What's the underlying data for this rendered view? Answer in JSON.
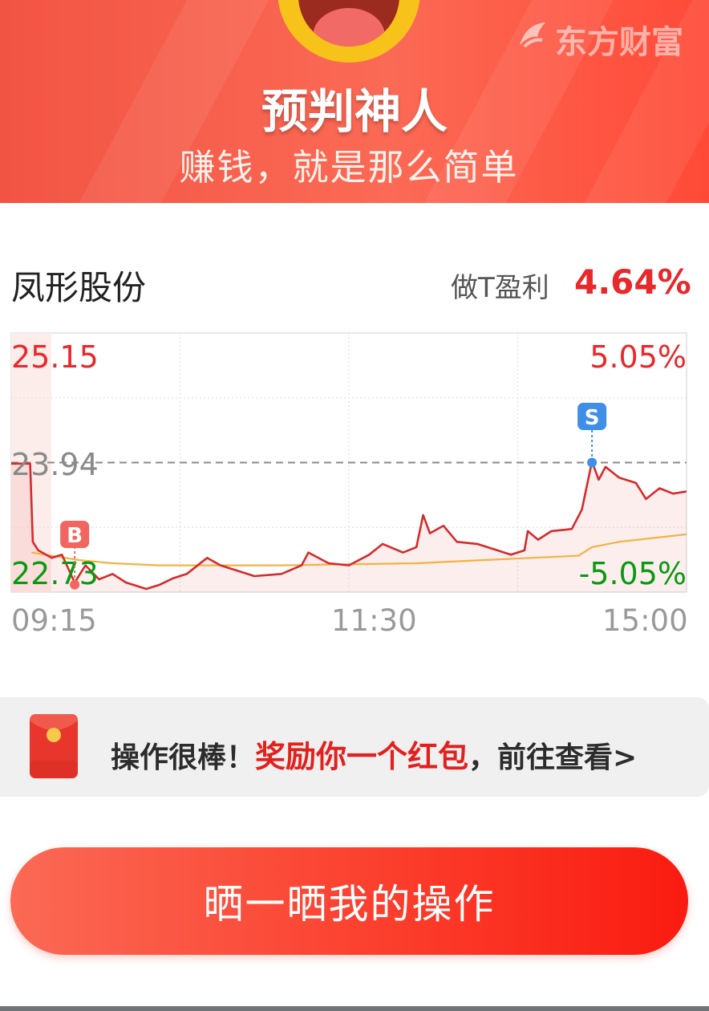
{
  "header": {
    "brand": "东方财富",
    "title": "预判神人",
    "subtitle": "赚钱，就是那么简单"
  },
  "stock": {
    "name": "凤形股份",
    "profit_label": "做T盈利",
    "profit_value": "4.64%"
  },
  "chart_data": {
    "type": "line",
    "y_high_label": "25.15",
    "y_ref_label": "23.94",
    "y_low_label": "22.73",
    "pct_high_label": "5.05%",
    "pct_low_label": "-5.05%",
    "x_ticks": [
      "09:15",
      "11:30",
      "15:00"
    ],
    "ylim": [
      22.73,
      25.15
    ],
    "ref_price": 23.94,
    "markers": [
      {
        "label": "B",
        "x": 0.094,
        "y": 22.8
      },
      {
        "label": "S",
        "x": 0.86,
        "y": 23.94
      }
    ],
    "price_series": [
      [
        0.0,
        23.93
      ],
      [
        0.028,
        23.93
      ],
      [
        0.032,
        23.2
      ],
      [
        0.04,
        23.12
      ],
      [
        0.06,
        23.05
      ],
      [
        0.075,
        23.08
      ],
      [
        0.094,
        22.82
      ],
      [
        0.11,
        22.98
      ],
      [
        0.13,
        22.85
      ],
      [
        0.15,
        22.9
      ],
      [
        0.17,
        22.82
      ],
      [
        0.2,
        22.76
      ],
      [
        0.22,
        22.8
      ],
      [
        0.24,
        22.86
      ],
      [
        0.26,
        22.9
      ],
      [
        0.29,
        23.05
      ],
      [
        0.31,
        22.98
      ],
      [
        0.34,
        22.92
      ],
      [
        0.36,
        22.88
      ],
      [
        0.4,
        22.9
      ],
      [
        0.43,
        22.98
      ],
      [
        0.44,
        23.1
      ],
      [
        0.47,
        23.0
      ],
      [
        0.5,
        22.98
      ],
      [
        0.53,
        23.08
      ],
      [
        0.55,
        23.18
      ],
      [
        0.58,
        23.1
      ],
      [
        0.6,
        23.15
      ],
      [
        0.61,
        23.45
      ],
      [
        0.62,
        23.28
      ],
      [
        0.64,
        23.35
      ],
      [
        0.66,
        23.2
      ],
      [
        0.69,
        23.18
      ],
      [
        0.72,
        23.12
      ],
      [
        0.74,
        23.08
      ],
      [
        0.76,
        23.12
      ],
      [
        0.765,
        23.3
      ],
      [
        0.78,
        23.22
      ],
      [
        0.8,
        23.3
      ],
      [
        0.83,
        23.32
      ],
      [
        0.845,
        23.5
      ],
      [
        0.86,
        23.95
      ],
      [
        0.87,
        23.78
      ],
      [
        0.88,
        23.9
      ],
      [
        0.9,
        23.8
      ],
      [
        0.925,
        23.75
      ],
      [
        0.94,
        23.6
      ],
      [
        0.96,
        23.7
      ],
      [
        0.98,
        23.65
      ],
      [
        1.0,
        23.67
      ]
    ],
    "avg_series": [
      [
        0.03,
        23.1
      ],
      [
        0.1,
        23.03
      ],
      [
        0.15,
        23.0
      ],
      [
        0.22,
        22.98
      ],
      [
        0.4,
        22.98
      ],
      [
        0.6,
        23.0
      ],
      [
        0.7,
        23.03
      ],
      [
        0.84,
        23.07
      ],
      [
        0.86,
        23.15
      ],
      [
        0.9,
        23.2
      ],
      [
        1.0,
        23.27
      ]
    ]
  },
  "reward": {
    "prefix": "操作很棒！",
    "highlight": "奖励你一个红包",
    "suffix": "，前往查看>"
  },
  "share_button": {
    "label": "晒一晒我的操作"
  },
  "colors": {
    "red": "#e8282b",
    "green": "#0a9a12",
    "avg_line": "#f3b243",
    "buy_marker": "#f2665f",
    "sell_marker": "#3f8ee8"
  }
}
